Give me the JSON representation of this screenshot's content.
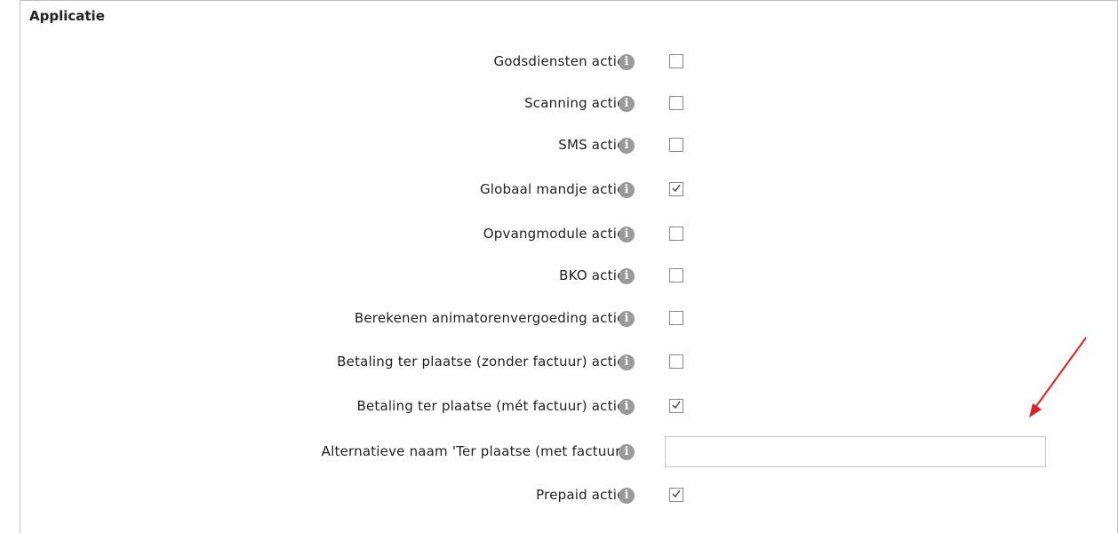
{
  "section": {
    "title": "Applicatie"
  },
  "settings": [
    {
      "label": "Godsdiensten actief",
      "checked": false
    },
    {
      "label": "Scanning actief",
      "checked": false
    },
    {
      "label": "SMS actief",
      "checked": false
    },
    {
      "label": "Globaal mandje actief",
      "checked": true
    },
    {
      "label": "Opvangmodule actief",
      "checked": false
    },
    {
      "label": "BKO actief",
      "checked": false
    },
    {
      "label": "Berekenen animatorenvergoeding actief",
      "checked": false
    },
    {
      "label": "Betaling ter plaatse (zonder factuur) actief",
      "checked": false
    },
    {
      "label": "Betaling ter plaatse (mét factuur) actief",
      "checked": true
    }
  ],
  "alt_name": {
    "label": "Alternatieve naam 'Ter plaatse (met factuur)'",
    "value": "",
    "placeholder": ""
  },
  "prepaid": {
    "label": "Prepaid actief",
    "checked": true
  },
  "icons": {
    "info": "info-icon",
    "annotation": "red-arrow-annotation"
  },
  "colors": {
    "info_icon": "#9a9a9a",
    "arrow": "#e02020"
  }
}
